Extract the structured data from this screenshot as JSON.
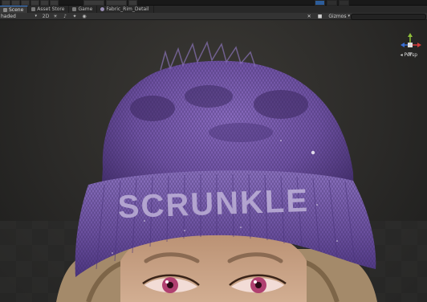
{
  "tabs": [
    {
      "label": "Scene",
      "active": true,
      "icon": "scene-icon"
    },
    {
      "label": "Asset Store",
      "active": false,
      "icon": "store-icon"
    },
    {
      "label": "Game",
      "active": false,
      "icon": "game-icon"
    },
    {
      "label": "Fabric_Rim_Detail",
      "active": false,
      "icon": "material-icon"
    }
  ],
  "scene_toolbar": {
    "shading_mode": "haded",
    "gizmos_label": "Gizmos",
    "scale_2d": "2D"
  },
  "viewport": {
    "projection": "Persp",
    "beanie_text": "SCRUNKLE",
    "colors": {
      "hat_main": "#7a5cae",
      "hat_shadow": "#3d2a63",
      "hat_highlight": "#b8a4dc",
      "background": "#2b2a28",
      "skin": "#caa589",
      "hair": "#a48a6a",
      "iris": "#b04070"
    }
  }
}
